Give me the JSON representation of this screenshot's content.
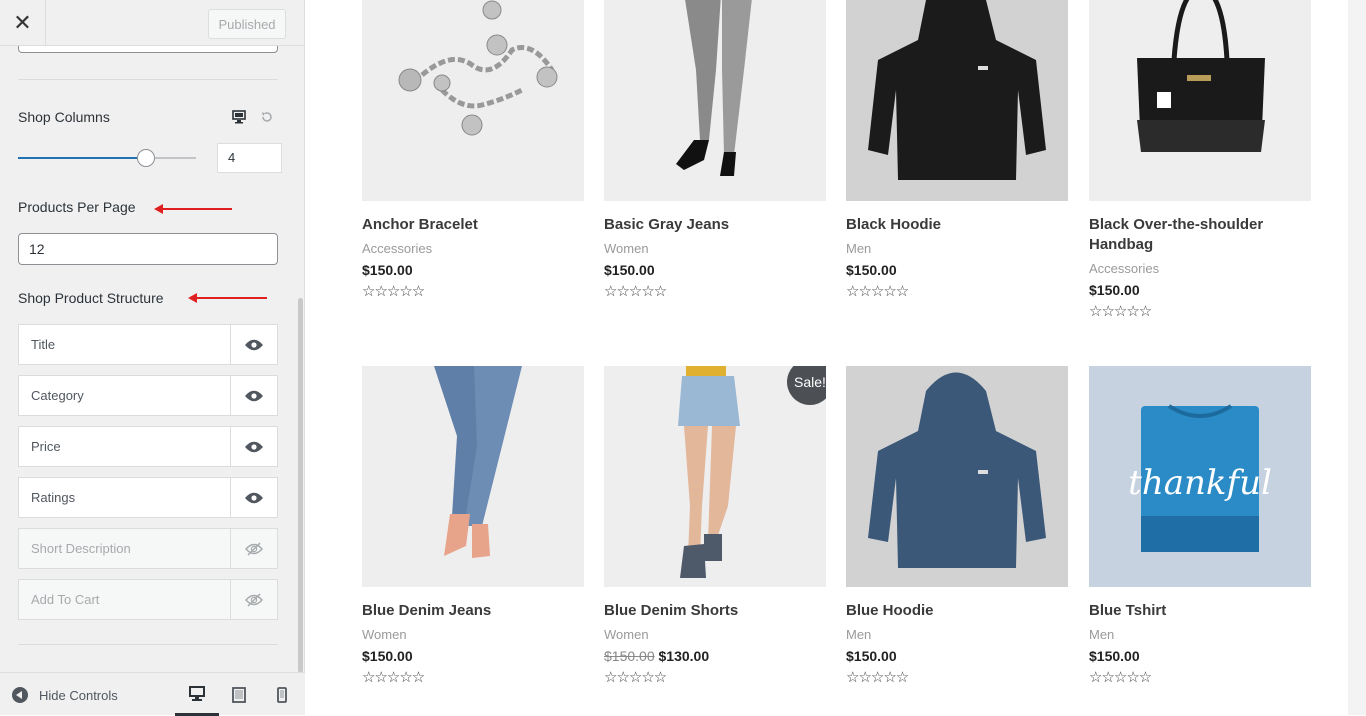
{
  "customizer": {
    "close_icon": "close-icon",
    "publish_label": "Published",
    "shop_columns": {
      "label": "Shop Columns",
      "value": "4",
      "slider_fraction": 0.72
    },
    "products_per_page": {
      "label": "Products Per Page",
      "value": "12"
    },
    "shop_product_structure": {
      "label": "Shop Product Structure",
      "items": [
        {
          "label": "Title",
          "visible": true
        },
        {
          "label": "Category",
          "visible": true
        },
        {
          "label": "Price",
          "visible": true
        },
        {
          "label": "Ratings",
          "visible": true
        },
        {
          "label": "Short Description",
          "visible": false
        },
        {
          "label": "Add To Cart",
          "visible": false
        }
      ]
    },
    "footer": {
      "hide_controls_label": "Hide Controls",
      "devices": [
        "desktop",
        "tablet",
        "mobile"
      ],
      "active_device": "desktop"
    }
  },
  "products": [
    {
      "title": "Anchor Bracelet",
      "category": "Accessories",
      "price": "$150.00"
    },
    {
      "title": "Basic Gray Jeans",
      "category": "Women",
      "price": "$150.00"
    },
    {
      "title": "Black Hoodie",
      "category": "Men",
      "price": "$150.00"
    },
    {
      "title": "Black Over-the-shoulder Handbag",
      "category": "Accessories",
      "price": "$150.00"
    },
    {
      "title": "Blue Denim Jeans",
      "category": "Women",
      "price": "$150.00"
    },
    {
      "title": "Blue Denim Shorts",
      "category": "Women",
      "old_price": "$150.00",
      "price": "$130.00",
      "badge": "Sale!"
    },
    {
      "title": "Blue Hoodie",
      "category": "Men",
      "price": "$150.00"
    },
    {
      "title": "Blue Tshirt",
      "category": "Men",
      "price": "$150.00",
      "image_text": "thankful"
    }
  ],
  "stars": "☆☆☆☆☆",
  "colors": {
    "accent": "#2271b1",
    "annotation_arrow": "#e02020",
    "sale_badge": "#4c4f54"
  }
}
